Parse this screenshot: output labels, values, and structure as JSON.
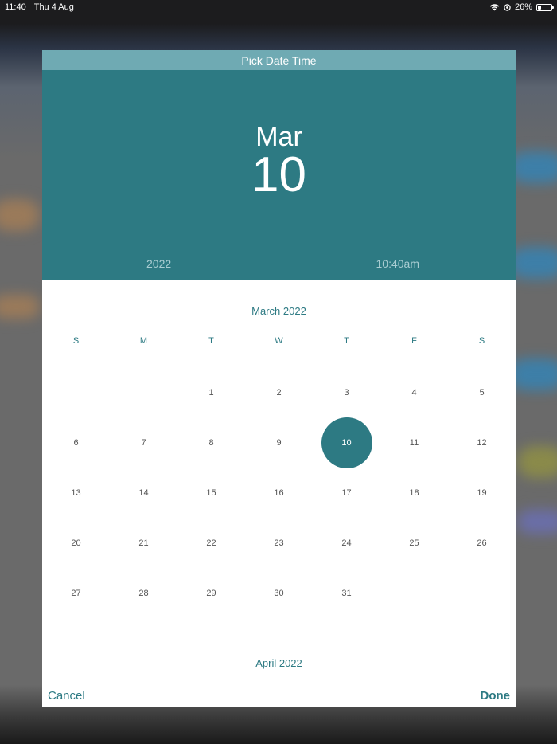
{
  "status_bar": {
    "time": "11:40",
    "date": "Thu 4 Aug",
    "battery_percent": "26%",
    "battery_level": 0.26,
    "icons": [
      "wifi-icon",
      "location-icon",
      "battery-icon"
    ]
  },
  "dialog": {
    "title": "Pick Date Time",
    "header": {
      "month": "Mar",
      "day": "10",
      "year": "2022",
      "time": "10:40am"
    },
    "calendar": {
      "month_title": "March 2022",
      "weekdays": [
        "S",
        "M",
        "T",
        "W",
        "T",
        "F",
        "S"
      ],
      "leading_blanks": 2,
      "days_in_month": 31,
      "selected_day": 10,
      "next_month_title": "April 2022"
    },
    "actions": {
      "cancel_label": "Cancel",
      "done_label": "Done"
    }
  },
  "colors": {
    "accent": "#2d7a83",
    "title_bar": "#6faab3",
    "header_secondary_text": "#a9cdd2",
    "day_text": "#555555"
  }
}
